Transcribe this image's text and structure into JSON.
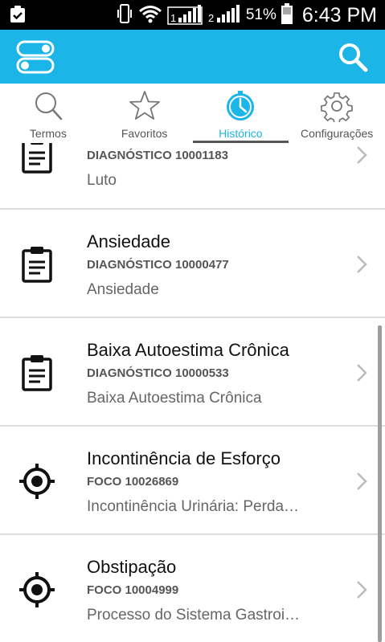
{
  "status_bar": {
    "battery_percent": "51%",
    "time": "6:43 PM",
    "icons": [
      "clipboard-check-icon",
      "vibrate-icon",
      "wifi-icon",
      "signal-sim1-icon",
      "signal-sim2-icon",
      "battery-icon"
    ]
  },
  "app_bar": {
    "background": "#1cb5e8",
    "menu_icon": "toggle-switches-icon",
    "search_icon": "search-icon"
  },
  "tabs": [
    {
      "label": "Termos",
      "icon": "magnifier-icon",
      "active": false
    },
    {
      "label": "Favoritos",
      "icon": "star-icon",
      "active": false
    },
    {
      "label": "Histórico",
      "icon": "clock-icon",
      "active": true
    },
    {
      "label": "Configurações",
      "icon": "gear-icon",
      "active": false
    }
  ],
  "accent_color": "#1cb5e8",
  "items": [
    {
      "title": "",
      "code": "DIAGNÓSTICO 10001183",
      "description": "Luto",
      "icon": "clipboard-list-icon"
    },
    {
      "title": "Ansiedade",
      "code": "DIAGNÓSTICO 10000477",
      "description": "Ansiedade",
      "icon": "clipboard-list-icon"
    },
    {
      "title": "Baixa Autoestima Crônica",
      "code": "DIAGNÓSTICO 10000533",
      "description": "Baixa Autoestima Crônica",
      "icon": "clipboard-list-icon"
    },
    {
      "title": "Incontinência de Esforço",
      "code": "FOCO 10026869",
      "description": "Incontinência Urinária: Perda…",
      "icon": "target-icon"
    },
    {
      "title": "Obstipação",
      "code": "FOCO 10004999",
      "description": "Processo do Sistema Gastroi…",
      "icon": "target-icon"
    }
  ]
}
